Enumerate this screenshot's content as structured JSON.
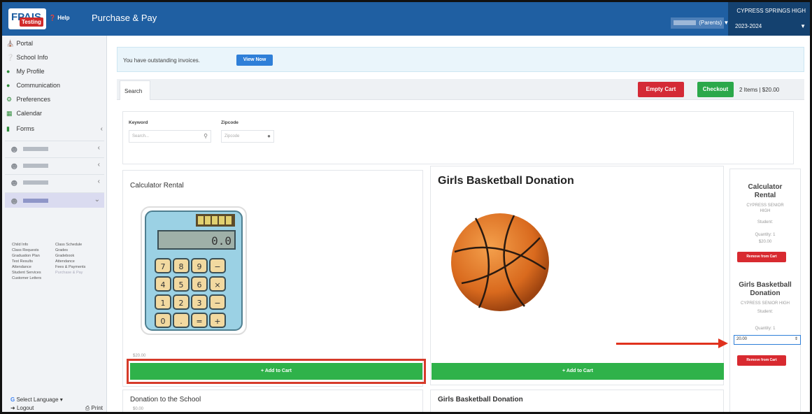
{
  "header": {
    "logo_text": "FPAIS",
    "logo_badge": "Testing",
    "help_label": "Help",
    "app_title": "Purchase & Pay",
    "user_role": "(Parents)",
    "school_name": "CYPRESS SPRINGS HIGH",
    "school_year": "2023-2024"
  },
  "sidebar": {
    "items": [
      {
        "icon": "home-icon",
        "label": "Portal"
      },
      {
        "icon": "info-icon",
        "label": "School Info"
      },
      {
        "icon": "person-icon",
        "label": "My Profile"
      },
      {
        "icon": "chat-icon",
        "label": "Communication"
      },
      {
        "icon": "gear-icon",
        "label": "Preferences"
      },
      {
        "icon": "calendar-icon",
        "label": "Calendar"
      },
      {
        "icon": "file-icon",
        "label": "Forms"
      }
    ],
    "sublinks": [
      "Child Info",
      "Class Schedule",
      "Class Requests",
      "Grades",
      "Graduation Plan",
      "Gradebook",
      "Test Results",
      "Attendance",
      "Attendance",
      "Fees & Payments",
      "Student Services",
      "Purchase & Pay",
      "Customer Letters"
    ],
    "language_label": "Select Language",
    "logout_label": "Logout",
    "print_label": "Print"
  },
  "notice": {
    "text": "You have outstanding invoices.",
    "button_label": "View Now"
  },
  "toolbar": {
    "search_tab": "Search",
    "empty_cart": "Empty Cart",
    "checkout": "Checkout",
    "cart_summary": "2 Items | $20.00"
  },
  "filters": {
    "keyword_label": "Keyword",
    "keyword_placeholder": "Search...",
    "zipcode_label": "Zipcode",
    "zipcode_placeholder": "Zipcode"
  },
  "products": {
    "calculator": {
      "title": "Calculator Rental",
      "price": "$20.00",
      "button": "+ Add to Cart"
    },
    "basketball": {
      "title": "Girls Basketball Donation",
      "button": "+ Add to Cart"
    },
    "donation_school": {
      "title": "Donation to the School",
      "price": "$0.00"
    },
    "basketball2": {
      "title": "Girls Basketball Donation"
    }
  },
  "cart": {
    "item1_title": "Calculator Rental",
    "item1_school": "CYPRESS SENIOR HIGH",
    "item1_student": "Student:",
    "item1_qty": "Quantity: 1",
    "item1_price": "$20.00",
    "item1_remove": "Remove from Cart",
    "item2_title": "Girls Basketball Donation",
    "item2_school": "CYPRESS SENIOR HIGH",
    "item2_student": "Student:",
    "item2_qty": "Quantity: 1",
    "item2_amount": "20.00",
    "item2_remove": "Remove from Cart"
  },
  "colors": {
    "header_blue": "#1f5fa2",
    "add_green": "#2fb24a",
    "danger_red": "#d42a36",
    "annotation_red": "#e0321e"
  }
}
